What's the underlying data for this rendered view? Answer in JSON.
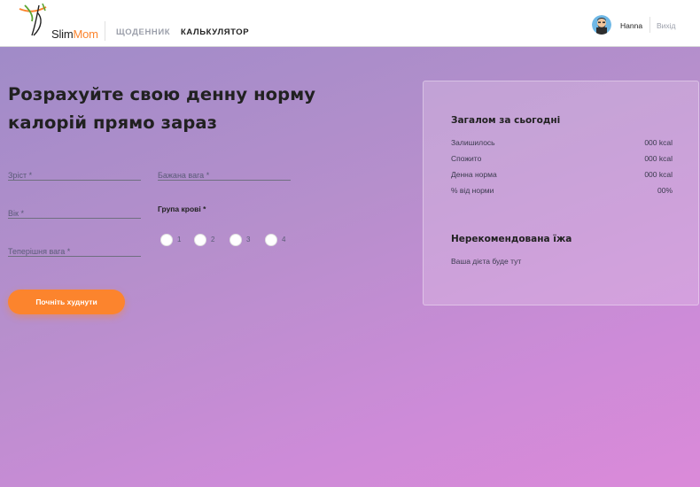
{
  "header": {
    "logo": {
      "text_main": "Slim",
      "text_accent": "Mom",
      "icon": "slimmom-logo-icon"
    },
    "nav": [
      {
        "label": "ЩОДЕННИК"
      },
      {
        "label": "КАЛЬКУЛЯТОР"
      }
    ],
    "user": {
      "name": "Hanna",
      "avatar_icon": "user-avatar-icon"
    },
    "logout_label": "Вихід"
  },
  "form": {
    "title": "Розрахуйте свою денну норму калорій прямо зараз",
    "fields": {
      "height": {
        "placeholder": "Зріст *",
        "value": ""
      },
      "desired_weight": {
        "placeholder": "Бажана вага *",
        "value": ""
      },
      "age": {
        "placeholder": "Вік *",
        "value": ""
      },
      "current_weight": {
        "placeholder": "Теперішня вага *",
        "value": ""
      }
    },
    "blood_group": {
      "label": "Група крові *",
      "options": [
        "1",
        "2",
        "3",
        "4"
      ]
    },
    "submit_label": "Почніть худнути"
  },
  "summary": {
    "title": "Загалом за сьогодні",
    "rows": [
      {
        "label": "Залишилось",
        "value": "000 kcal"
      },
      {
        "label": "Спожито",
        "value": "000 kcal"
      },
      {
        "label": "Денна норма",
        "value": "000 kcal"
      },
      {
        "label": "% від норми",
        "value": "00%"
      }
    ],
    "food_title": "Нерекомендована їжа",
    "food_text": "Ваша дієта буде тут"
  },
  "colors": {
    "accent": "#fc842d",
    "gradient_start": "#a08bc8",
    "gradient_end": "#db8ad9"
  }
}
